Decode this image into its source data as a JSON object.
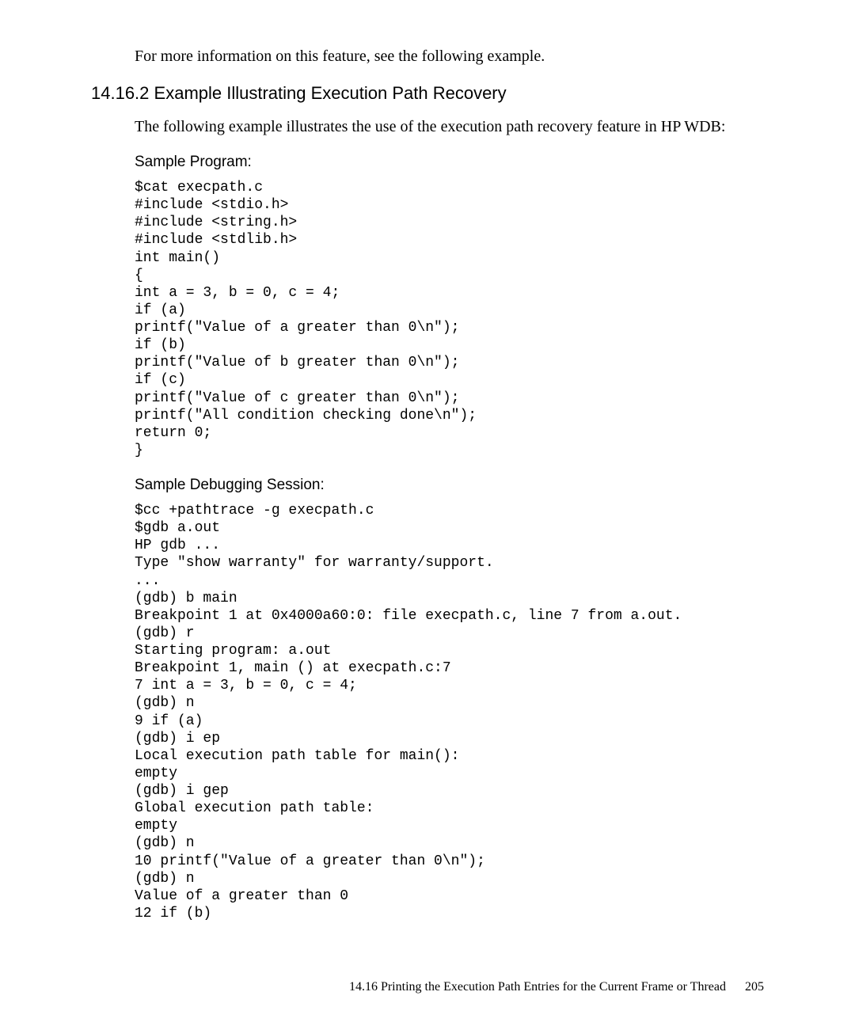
{
  "intro": "For more information on this feature, see the following example.",
  "section": {
    "number": "14.16.2",
    "title": "Example Illustrating Execution Path Recovery"
  },
  "body": "The following example illustrates the use of the execution path recovery feature in HP WDB:",
  "sample_program": {
    "heading": "Sample Program:",
    "code": "$cat execpath.c\n#include <stdio.h>\n#include <string.h>\n#include <stdlib.h>\nint main()\n{\nint a = 3, b = 0, c = 4;\nif (a)\nprintf(\"Value of a greater than 0\\n\");\nif (b)\nprintf(\"Value of b greater than 0\\n\");\nif (c)\nprintf(\"Value of c greater than 0\\n\");\nprintf(\"All condition checking done\\n\");\nreturn 0;\n}"
  },
  "sample_session": {
    "heading": "Sample Debugging Session:",
    "code": "$cc +pathtrace -g execpath.c\n$gdb a.out\nHP gdb ...\nType \"show warranty\" for warranty/support.\n...\n(gdb) b main\nBreakpoint 1 at 0x4000a60:0: file execpath.c, line 7 from a.out.\n(gdb) r\nStarting program: a.out\nBreakpoint 1, main () at execpath.c:7\n7 int a = 3, b = 0, c = 4;\n(gdb) n\n9 if (a)\n(gdb) i ep\nLocal execution path table for main():\nempty\n(gdb) i gep\nGlobal execution path table:\nempty\n(gdb) n\n10 printf(\"Value of a greater than 0\\n\");\n(gdb) n\nValue of a greater than 0\n12 if (b)"
  },
  "footer": {
    "text": "14.16 Printing the Execution Path Entries for the Current Frame or Thread",
    "page": "205"
  }
}
